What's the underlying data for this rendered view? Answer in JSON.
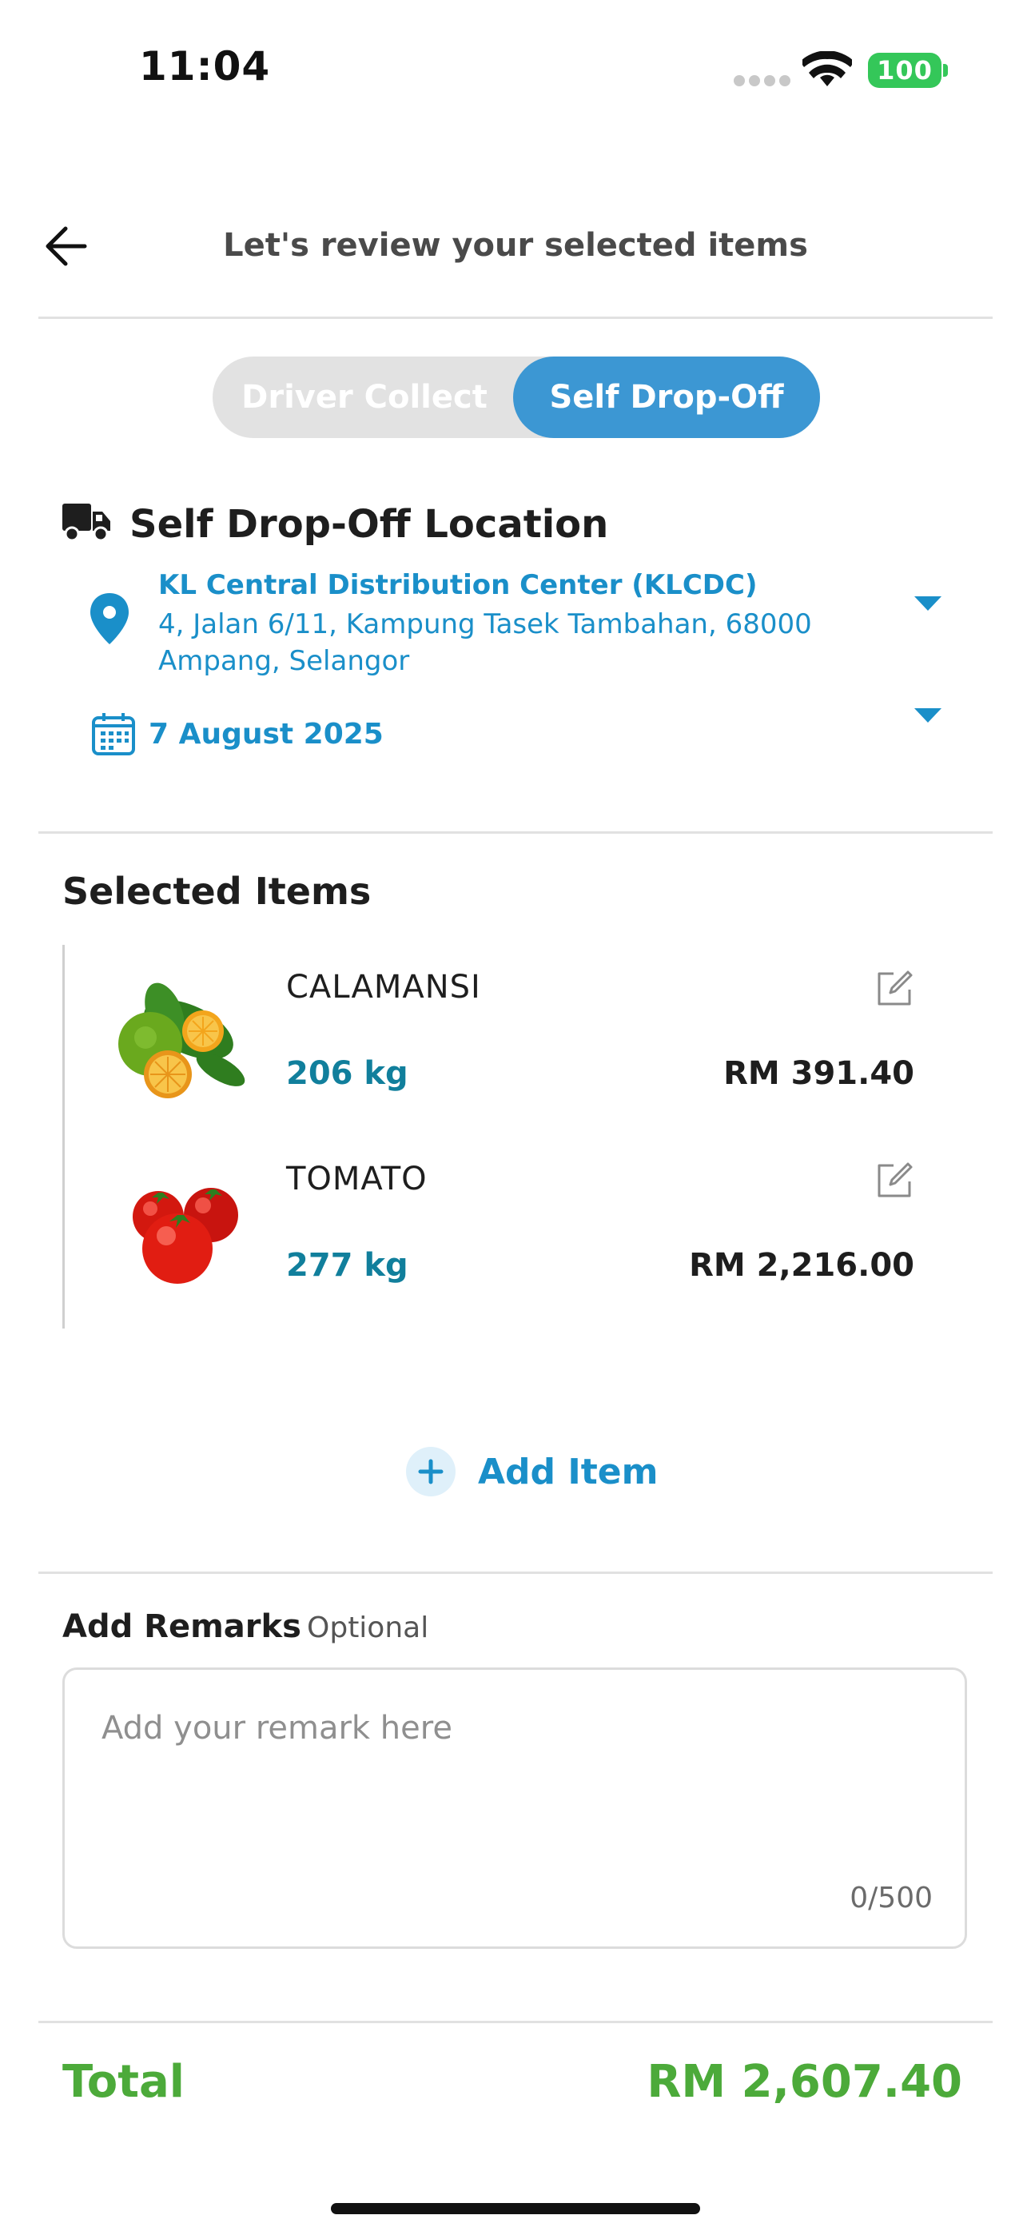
{
  "status_bar": {
    "time": "11:04",
    "battery": "100"
  },
  "header": {
    "title": "Let's review your selected items"
  },
  "toggle": {
    "options": [
      "Driver Collect",
      "Self Drop-Off"
    ],
    "selected": "Self Drop-Off"
  },
  "location": {
    "heading": "Self Drop-Off Location",
    "name": "KL Central Distribution Center (KLCDC)",
    "address": "4, Jalan 6/11, Kampung Tasek Tambahan, 68000 Ampang, Selangor",
    "date": "7 August 2025"
  },
  "items": {
    "title": "Selected Items",
    "list": [
      {
        "name": "CALAMANSI",
        "quantity": "206 kg",
        "price": "RM 391.40"
      },
      {
        "name": "TOMATO",
        "quantity": "277 kg",
        "price": "RM 2,216.00"
      }
    ],
    "add_label": "Add Item"
  },
  "remarks": {
    "title": "Add Remarks",
    "optional_label": "Optional",
    "placeholder": "Add your remark here",
    "counter": "0/500"
  },
  "total": {
    "label": "Total",
    "value": "RM 2,607.40"
  },
  "colors": {
    "accent": "#1a8fc9",
    "toggle_active": "#3c97d3",
    "quantity": "#117f9c",
    "total": "#4caa3a",
    "battery": "#34c759"
  }
}
